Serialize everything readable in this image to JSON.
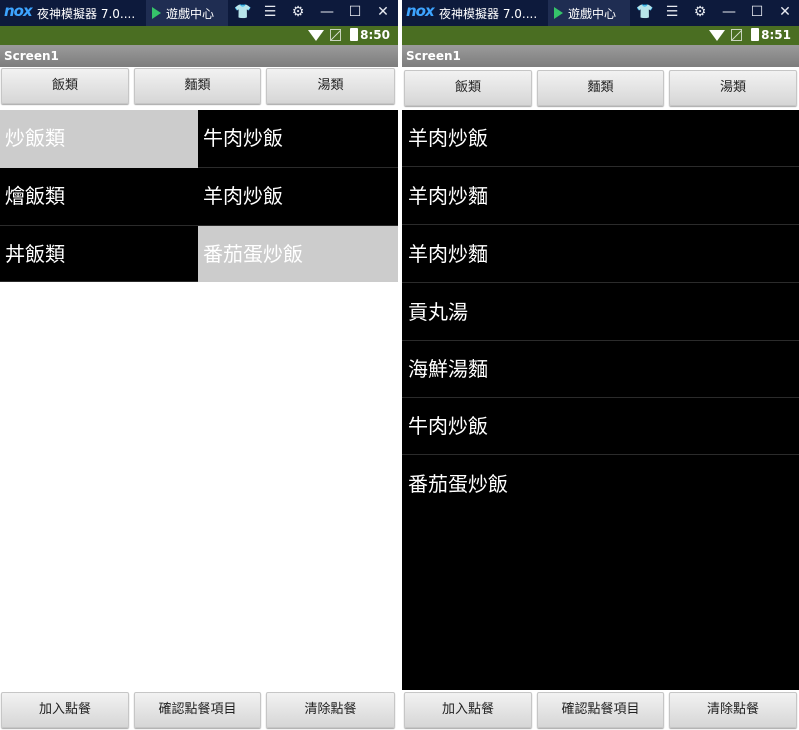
{
  "left": {
    "titlebar": {
      "brand": "nox",
      "title": "夜神模擬器 7.0....",
      "game_tab": "遊戲中心"
    },
    "icons": {
      "shirt": "👕",
      "menu": "☰",
      "gear": "⚙",
      "min": "—",
      "max": "☐",
      "close": "✕"
    },
    "status_time": "8:50",
    "appbar_title": "Screen1",
    "tabs": [
      {
        "label": "飯類"
      },
      {
        "label": "麵類"
      },
      {
        "label": "湯類"
      }
    ],
    "categories": [
      {
        "label": "炒飯類",
        "selected": true
      },
      {
        "label": "燴飯類",
        "selected": false
      },
      {
        "label": "丼飯類",
        "selected": false
      }
    ],
    "dishes": [
      {
        "label": "牛肉炒飯",
        "selected": false
      },
      {
        "label": "羊肉炒飯",
        "selected": false
      },
      {
        "label": "番茄蛋炒飯",
        "selected": true
      }
    ],
    "bottom": [
      {
        "label": "加入點餐"
      },
      {
        "label": "確認點餐項目"
      },
      {
        "label": "清除點餐"
      }
    ]
  },
  "right": {
    "titlebar": {
      "brand": "nox",
      "title": "夜神模擬器 7.0....",
      "game_tab": "遊戲中心"
    },
    "icons": {
      "shirt": "👕",
      "menu": "☰",
      "gear": "⚙",
      "min": "—",
      "max": "☐",
      "close": "✕"
    },
    "status_time": "8:51",
    "appbar_title": "Screen1",
    "tabs": [
      {
        "label": "飯類"
      },
      {
        "label": "麵類"
      },
      {
        "label": "湯類"
      }
    ],
    "order_list": [
      {
        "label": "羊肉炒飯"
      },
      {
        "label": "羊肉炒麵"
      },
      {
        "label": "羊肉炒麵"
      },
      {
        "label": "貢丸湯"
      },
      {
        "label": "海鮮湯麵"
      },
      {
        "label": "牛肉炒飯"
      },
      {
        "label": "番茄蛋炒飯"
      }
    ],
    "bottom": [
      {
        "label": "加入點餐"
      },
      {
        "label": "確認點餐項目"
      },
      {
        "label": "清除點餐"
      }
    ]
  },
  "colors": {
    "titlebar_bg": "#0d1a3c",
    "statusbar_bg": "#4a6e22",
    "list_bg": "#000000",
    "selected_cell": "#cccccc",
    "brand": "#3da4ff"
  }
}
